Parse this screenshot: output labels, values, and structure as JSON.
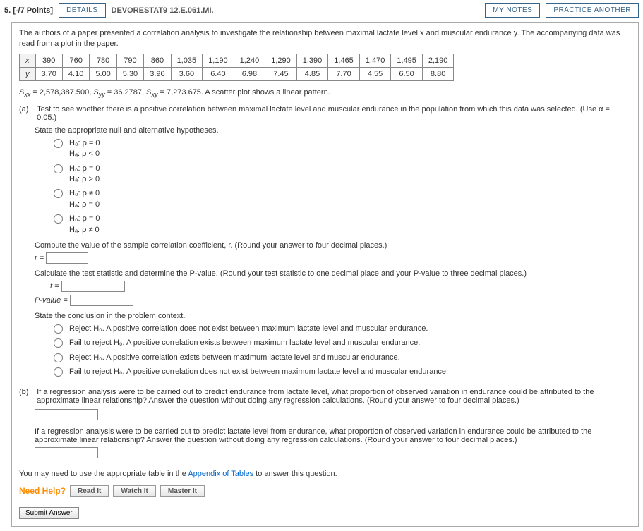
{
  "header": {
    "points": "5. [-/7 Points]",
    "details": "DETAILS",
    "book": "DEVORESTAT9 12.E.061.MI.",
    "notes": "MY NOTES",
    "practice": "PRACTICE ANOTHER"
  },
  "intro": "The authors of a paper presented a correlation analysis to investigate the relationship between maximal lactate level x and muscular endurance y. The accompanying data was read from a plot in the paper.",
  "table": {
    "rowLabels": [
      "x",
      "y"
    ],
    "x": [
      "390",
      "760",
      "780",
      "790",
      "860",
      "1,035",
      "1,190",
      "1,240",
      "1,290",
      "1,390",
      "1,465",
      "1,470",
      "1,495",
      "2,190"
    ],
    "y": [
      "3.70",
      "4.10",
      "5.00",
      "5.30",
      "3.90",
      "3.60",
      "6.40",
      "6.98",
      "7.45",
      "4.85",
      "7.70",
      "4.55",
      "6.50",
      "8.80"
    ]
  },
  "stats": {
    "prefix": "S",
    "sxx": " = 2,578,387.500, ",
    "syy": " = 36.2787, ",
    "sxy": " = 7,273.675. A scatter plot shows a linear pattern."
  },
  "partA": {
    "label": "(a)",
    "q": "Test to see whether there is a positive correlation between maximal lactate level and muscular endurance in the population from which this data was selected. (Use α = 0.05.)",
    "state": "State the appropriate null and alternative hypotheses.",
    "opts": [
      {
        "h0": "H₀: ρ = 0",
        "ha": "Hₐ: ρ < 0"
      },
      {
        "h0": "H₀: ρ = 0",
        "ha": "Hₐ: ρ > 0"
      },
      {
        "h0": "H₀: ρ ≠ 0",
        "ha": "Hₐ: ρ = 0"
      },
      {
        "h0": "H₀: ρ = 0",
        "ha": "Hₐ: ρ ≠ 0"
      }
    ],
    "compute_r": "Compute the value of the sample correlation coefficient, r. (Round your answer to four decimal places.)",
    "r_label": "r = ",
    "calc_t": "Calculate the test statistic and determine the P-value. (Round your test statistic to one decimal place and your P-value to three decimal places.)",
    "t_label": "t = ",
    "p_label": "P-value = ",
    "state_concl": "State the conclusion in the problem context.",
    "concls": [
      "Reject H₀. A positive correlation does not exist between maximum lactate level and muscular endurance.",
      "Fail to reject H₀. A positive correlation exists between maximum lactate level and muscular endurance.",
      "Reject H₀. A positive correlation exists between maximum lactate level and muscular endurance.",
      "Fail to reject H₀. A positive correlation does not exist between maximum lactate level and muscular endurance."
    ]
  },
  "partB": {
    "label": "(b)",
    "q1": "If a regression analysis were to be carried out to predict endurance from lactate level, what proportion of observed variation in endurance could be attributed to the approximate linear relationship? Answer the question without doing any regression calculations. (Round your answer to four decimal places.)",
    "q2": "If a regression analysis were to be carried out to predict lactate level from endurance, what proportion of observed variation in endurance could be attributed to the approximate linear relationship? Answer the question without doing any regression calculations. (Round your answer to four decimal places.)"
  },
  "footer": {
    "may_need1": "You may need to use the appropriate table in the ",
    "appendix": "Appendix of Tables",
    "may_need2": " to answer this question.",
    "need_help": "Need Help?",
    "read": "Read It",
    "watch": "Watch It",
    "master": "Master It",
    "submit": "Submit Answer"
  }
}
